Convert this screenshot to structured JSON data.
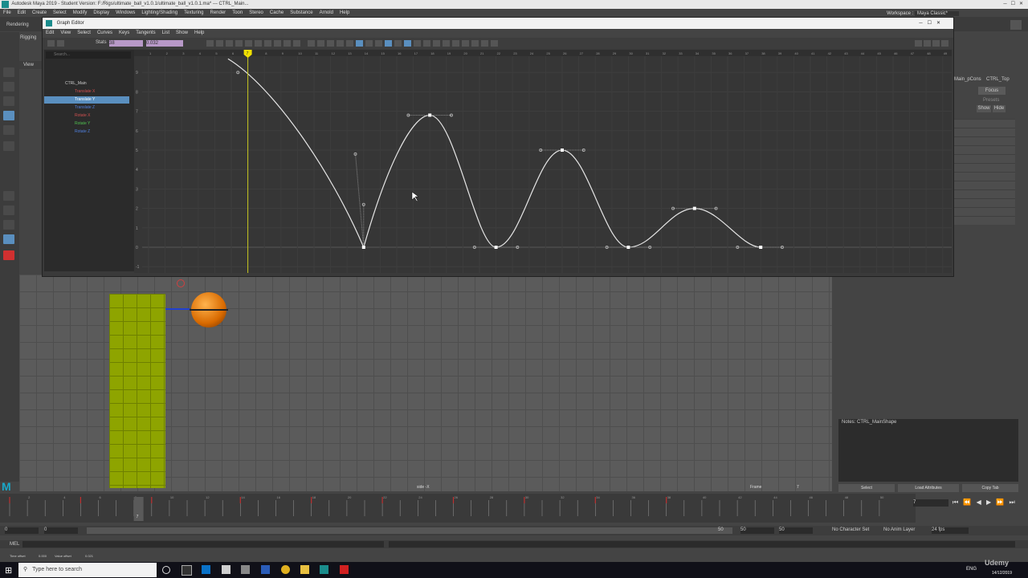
{
  "window": {
    "title": "Autodesk Maya 2019 - Student Version: F:/Rigs/ultimate_ball_v1.0.1/ultimate_ball_v1.0.1.ma*  ---  CTRL_Main..."
  },
  "menu": [
    "File",
    "Edit",
    "Create",
    "Select",
    "Modify",
    "Display",
    "Windows",
    "Lighting/Shading",
    "Texturing",
    "Render",
    "Toon",
    "Stereo",
    "Cache",
    "Substance",
    "Arnold",
    "Help"
  ],
  "workspace": {
    "label": "Workspace :",
    "value": "Maya Classic*"
  },
  "shelf_tabs": [
    "Rendering",
    "Rigging"
  ],
  "graph_editor": {
    "title": "Graph Editor",
    "menu": [
      "Edit",
      "View",
      "Select",
      "Curves",
      "Keys",
      "Tangents",
      "List",
      "Show",
      "Help"
    ],
    "stats_label": "Stats",
    "stats_values": [
      "38",
      "0.032"
    ],
    "search_placeholder": "Search...",
    "outliner": [
      {
        "label": "CTRL_Main",
        "color": "#cccccc",
        "selected": false
      },
      {
        "label": "Translate X",
        "color": "#d05050",
        "selected": false
      },
      {
        "label": "Translate Y",
        "color": "#ffffff",
        "selected": true
      },
      {
        "label": "Translate Z",
        "color": "#5080e0",
        "selected": false
      },
      {
        "label": "Rotate X",
        "color": "#d05050",
        "selected": false
      },
      {
        "label": "Rotate Y",
        "color": "#50c050",
        "selected": false
      },
      {
        "label": "Rotate Z",
        "color": "#5080e0",
        "selected": false
      }
    ],
    "current_frame": "7",
    "y_ticks": [
      "9",
      "8",
      "7",
      "6",
      "5",
      "4",
      "3",
      "2",
      "1",
      "0",
      "-1"
    ],
    "x_ticks": [
      "1",
      "2",
      "3",
      "4",
      "5",
      "6",
      "7",
      "8",
      "9",
      "10",
      "11",
      "12",
      "13",
      "14",
      "15",
      "16",
      "17",
      "18",
      "19",
      "20",
      "21",
      "22",
      "23",
      "24",
      "25",
      "26",
      "27",
      "28",
      "29",
      "30",
      "31",
      "32",
      "33",
      "34",
      "35",
      "36",
      "37",
      "38",
      "39",
      "40",
      "41",
      "42",
      "43",
      "44",
      "45",
      "46",
      "47",
      "48",
      "49"
    ]
  },
  "viewport": {
    "camera": "side -X",
    "frame_label": "Frame",
    "frame_value": "7",
    "view_menu": "View"
  },
  "right_panel": {
    "focus": "Focus",
    "presets": "Presets",
    "show": "Show",
    "hide": "Hide",
    "node": "CTRL_Top",
    "shape": "Main_pCons"
  },
  "notes": {
    "label": "Notes: CTRL_MainShape"
  },
  "attr_buttons": [
    "Select",
    "Load Attributes",
    "Copy Tab"
  ],
  "time_slider": {
    "current": "7",
    "ticks": [
      "1",
      "2",
      "3",
      "4",
      "5",
      "6",
      "7",
      "8",
      "9",
      "10",
      "11",
      "12",
      "13",
      "14",
      "15",
      "16",
      "17",
      "18",
      "19",
      "20",
      "21",
      "22",
      "23",
      "24",
      "25",
      "26",
      "27",
      "28",
      "29",
      "30",
      "31",
      "32",
      "33",
      "34",
      "35",
      "36",
      "37",
      "38",
      "39",
      "40",
      "41",
      "42",
      "43",
      "44",
      "45",
      "46",
      "47",
      "48",
      "49",
      "50"
    ]
  },
  "range": {
    "start": "0",
    "start2": "0",
    "end": "50",
    "end2": "50",
    "end3": "50",
    "character_set": "No Character Set",
    "anim_layer": "No Anim Layer",
    "fps": "24 fps"
  },
  "command_line": {
    "label": "MEL"
  },
  "help_line": {
    "time_offset_label": "Time offset",
    "time_offset": "0.000",
    "value_offset_label": "Value offset",
    "value_offset": "0.021"
  },
  "taskbar": {
    "search_placeholder": "Type here to search",
    "lang": "ENG",
    "time": "14/12/2019",
    "brand": "Udemy"
  }
}
